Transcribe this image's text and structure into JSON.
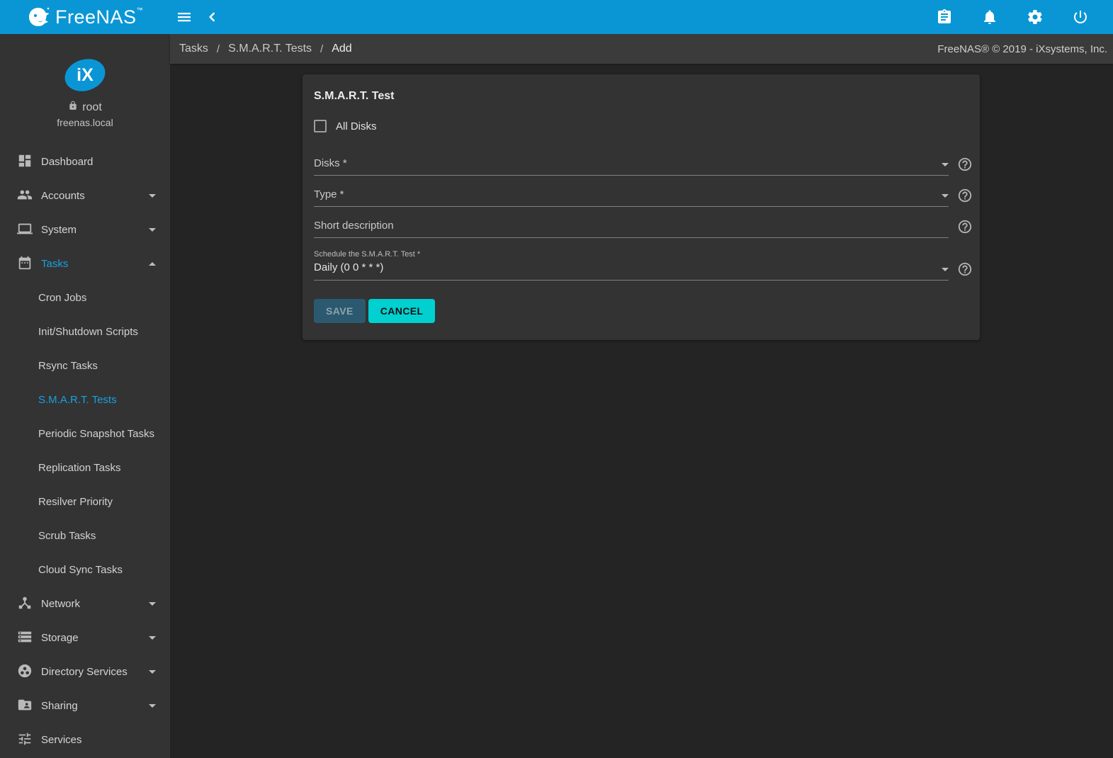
{
  "topbar": {
    "brand": "FreeNAS",
    "brand_tm": "™"
  },
  "breadcrumb": {
    "items": [
      "Tasks",
      "S.M.A.R.T. Tests",
      "Add"
    ],
    "separator": "/",
    "copyright": "FreeNAS® © 2019 - iXsystems, Inc."
  },
  "sidebar": {
    "user": {
      "name": "root",
      "host": "freenas.local"
    },
    "items": [
      {
        "label": "Dashboard"
      },
      {
        "label": "Accounts"
      },
      {
        "label": "System"
      },
      {
        "label": "Tasks"
      },
      {
        "label": "Cron Jobs"
      },
      {
        "label": "Init/Shutdown Scripts"
      },
      {
        "label": "Rsync Tasks"
      },
      {
        "label": "S.M.A.R.T. Tests"
      },
      {
        "label": "Periodic Snapshot Tasks"
      },
      {
        "label": "Replication Tasks"
      },
      {
        "label": "Resilver Priority"
      },
      {
        "label": "Scrub Tasks"
      },
      {
        "label": "Cloud Sync Tasks"
      },
      {
        "label": "Network"
      },
      {
        "label": "Storage"
      },
      {
        "label": "Directory Services"
      },
      {
        "label": "Sharing"
      },
      {
        "label": "Services"
      }
    ],
    "active_section": "Tasks",
    "active_item": "S.M.A.R.T. Tests"
  },
  "form": {
    "title": "S.M.A.R.T. Test",
    "all_disks_label": "All Disks",
    "all_disks_checked": false,
    "fields": [
      {
        "label": "Disks *",
        "type": "select",
        "value": ""
      },
      {
        "label": "Type *",
        "type": "select",
        "value": ""
      },
      {
        "label": "Short description",
        "type": "text",
        "value": ""
      },
      {
        "label": "Schedule the S.M.A.R.T. Test *",
        "type": "select",
        "value": "Daily (0 0 * * *)"
      }
    ],
    "save_label": "SAVE",
    "save_disabled": true,
    "cancel_label": "CANCEL"
  },
  "colors": {
    "topbar_blue": "#0a96d5",
    "accent_blue": "#18a1e0",
    "cancel_teal": "#00d0d0",
    "save_disabled_bg": "#2b5a70",
    "sidebar_bg": "#333333",
    "content_bg": "#242424",
    "card_bg": "#333333",
    "breadcrumb_bg": "#3b3b3b"
  }
}
